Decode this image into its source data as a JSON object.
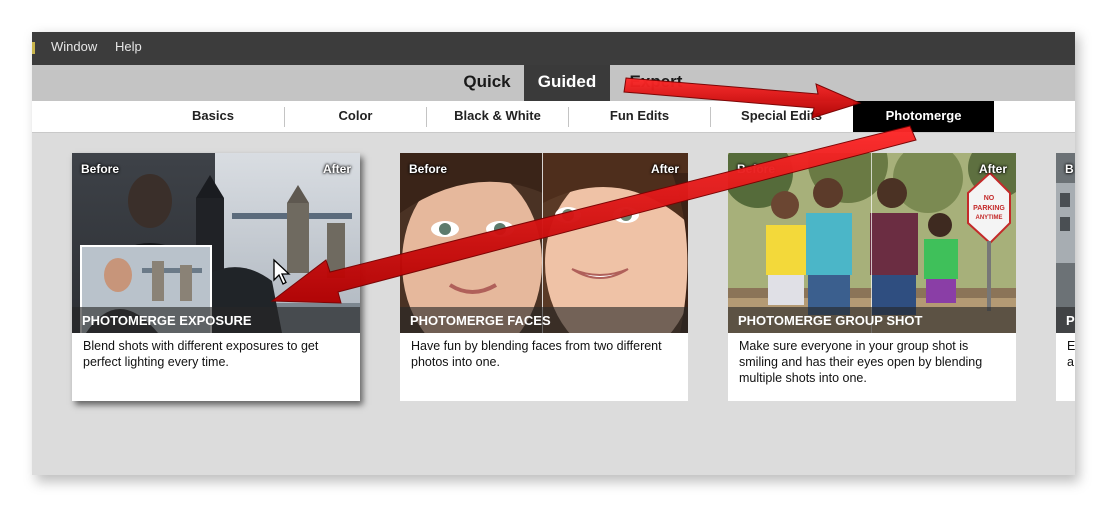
{
  "menu": {
    "window": "Window",
    "help": "Help"
  },
  "modes": {
    "quick": "Quick",
    "guided": "Guided",
    "expert": "Expert"
  },
  "categories": [
    "Basics",
    "Color",
    "Black & White",
    "Fun Edits",
    "Special Edits",
    "Photomerge"
  ],
  "active_category": "Photomerge",
  "cards": [
    {
      "before": "Before",
      "after": "After",
      "title": "PHOTOMERGE EXPOSURE",
      "description": "Blend shots with different exposures to get perfect lighting every time."
    },
    {
      "before": "Before",
      "after": "After",
      "title": "PHOTOMERGE FACES",
      "description": "Have fun by blending faces from two different photos into one."
    },
    {
      "before": "Before",
      "after": "After",
      "title": "PHOTOMERGE GROUP SHOT",
      "description": "Make sure everyone in your group shot is smiling and has their eyes open by blending multiple shots into one.",
      "sign": [
        "NO",
        "PARKING",
        "ANYTIME"
      ]
    },
    {
      "before": "B",
      "title": "P",
      "description": "E a"
    }
  ],
  "colors": {
    "menubar": "#3c3c3c",
    "active_tab": "#3a3a3a",
    "arrow": "#d40000",
    "background": "#dcdcdc"
  },
  "icons": [
    "mouse-cursor-icon",
    "annotation-arrow-icon"
  ]
}
